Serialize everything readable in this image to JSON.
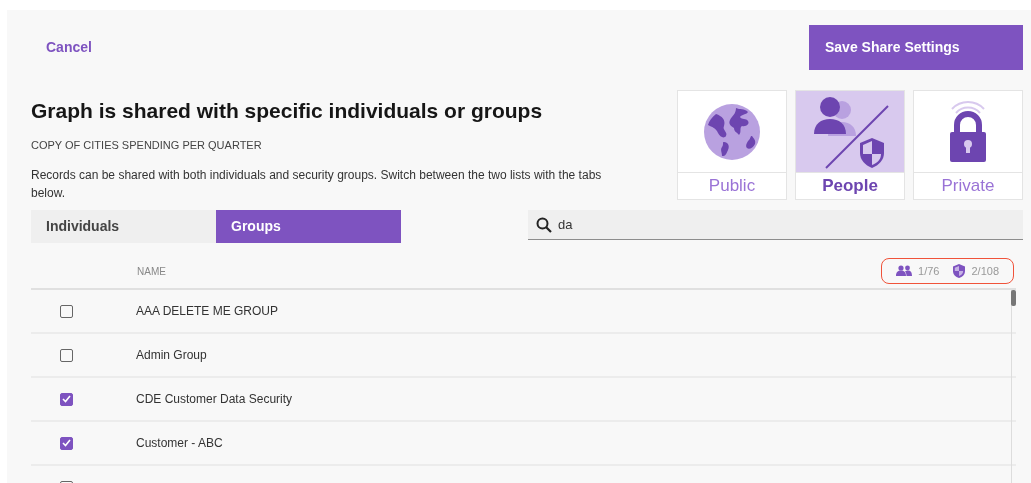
{
  "cancel": "Cancel",
  "save_button": "Save Share Settings",
  "title": "Graph is shared with specific individuals or groups",
  "subtitle": "COPY OF CITIES SPENDING PER QUARTER",
  "description": "Records can be shared with both individuals and security groups. Switch between the two lists with the tabs below.",
  "share_modes": [
    {
      "kind": "globe",
      "label": "Public",
      "selected": false
    },
    {
      "kind": "people",
      "label": "People",
      "selected": true
    },
    {
      "kind": "lock",
      "label": "Private",
      "selected": false
    }
  ],
  "tabs": [
    {
      "label": "Individuals",
      "selected": false
    },
    {
      "label": "Groups",
      "selected": true
    }
  ],
  "search": {
    "value": "da"
  },
  "column": "NAME",
  "counts": [
    {
      "kind": "people",
      "text": "1/76"
    },
    {
      "kind": "shield",
      "text": "2/108"
    }
  ],
  "rows": [
    {
      "name": "AAA DELETE ME GROUP",
      "checked": false
    },
    {
      "name": "Admin Group",
      "checked": false
    },
    {
      "name": "CDE Customer Data Security",
      "checked": true
    },
    {
      "name": "Customer - ABC",
      "checked": true
    },
    {
      "checked": false
    }
  ]
}
